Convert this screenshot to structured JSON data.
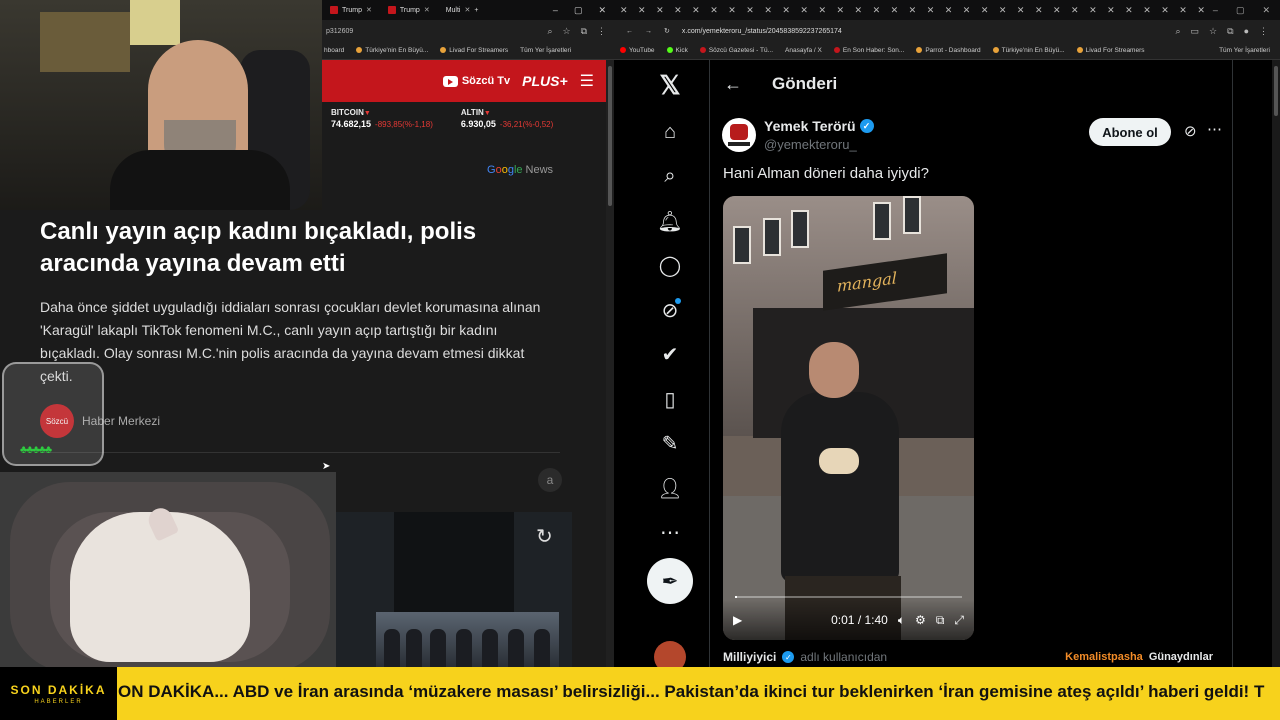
{
  "left_browser": {
    "tabs": [
      {
        "label": "Trump"
      },
      {
        "label": "Trump"
      },
      {
        "label": "Multi"
      }
    ],
    "address_fragment": "p312609",
    "bookmarks": [
      "hboard",
      "Türkiye'nin En Büyü...",
      "Livad For Streamers",
      "Tüm Yer İşaretleri"
    ],
    "site": {
      "tv_label": "Sözcü Tv",
      "plus_label": "PLUS+",
      "market": [
        {
          "name": "BITCOIN",
          "value": "74.682,15",
          "change": "-893,85(%-1,18)"
        },
        {
          "name": "ALTIN",
          "value": "6.930,05",
          "change": "-36,21(%-0,52)"
        }
      ],
      "google_news": {
        "g1": "G",
        "g2": "o",
        "g3": "o",
        "g4": "g",
        "g5": "le",
        "news": " News"
      },
      "headline": "Canlı yayın açıp kadını bıçakladı, polis aracında yayına devam etti",
      "summary": "Daha önce şiddet uyguladığı iddiaları sonrası çocukları devlet korumasına alınan 'Karagül' lakaplı TikTok fenomeni M.C., canlı yayın açıp tartıştığı bir kadını bıçakladı. Olay sonrası M.C.'nin polis aracında da yayına devam etmesi dikkat çekti.",
      "author": "Haber Merkezi",
      "author_avatar": "Sözcü",
      "share_letter": "a"
    }
  },
  "overlay": {
    "cup_clovers": "♣♣♣♣♣"
  },
  "right_browser": {
    "tab_strip": "✕ ✕ ✕ ✕ ✕ ✕ ✕ ✕ ✕ ✕ ✕ ✕ ✕ ✕ ✕ ✕ ✕ ✕ ✕ ✕ ✕ ✕ ✕ ✕ ✕ ✕ ✕ ✕ ✕ ✕ ✕ ✕ ✕ ✕ ✕ ✕ ✕ ✕ ✕ ✕ ✕ ✕ ✕ ✕ ✕ ✕ ✕ ✕ ✕ ✕",
    "url": "x.com/yemekteroru_/status/2045838592237265174",
    "bookmarks": [
      "YouTube",
      "Kick",
      "Sözcü Gazetesi - Tü...",
      "Anasayfa / X",
      "En Son Haber: Son...",
      "Parrot - Dashboard",
      "Türkiye'nin En Büyü...",
      "Livad For Streamers"
    ],
    "all_bookmarks": "Tüm Yer İşaretleri",
    "x": {
      "logo": "𝕏",
      "page_title": "Gönderi",
      "display_name": "Yemek Terörü",
      "handle": "@yemekteroru_",
      "subscribe_label": "Abone ol",
      "tweet_text": "Hani Alman döneri daha iyiydi?",
      "video": {
        "sign_text": "mangal",
        "time": "0:01 / 1:40",
        "progress": 0.01
      },
      "reply": {
        "username": "Milliyiyici",
        "note": "adlı kullanıcıdan",
        "tag1": "Kemalistpasha",
        "tag2": "Günaydınlar"
      }
    }
  },
  "ticker": {
    "label": "SON DAKİKA",
    "sublabel": "HABERLER",
    "text": "ON DAKİKA... ABD ve İran arasında ‘müzakere masası’ belirsizliği... Pakistan’da ikinci tur beklenirken ‘İran gemisine ateş açıldı’ haberi geldi! T"
  }
}
